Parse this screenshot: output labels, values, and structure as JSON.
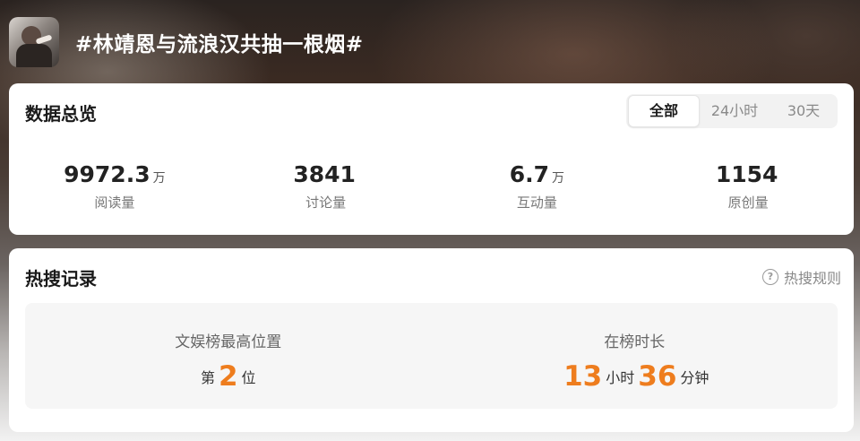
{
  "topic": {
    "title": "#林靖恩与流浪汉共抽一根烟#",
    "avatar_icon": "user-avatar"
  },
  "overview": {
    "title": "数据总览",
    "tabs": [
      {
        "label": "全部",
        "active": true
      },
      {
        "label": "24小时",
        "active": false
      },
      {
        "label": "30天",
        "active": false
      }
    ],
    "stats": [
      {
        "value": "9972.3",
        "unit": "万",
        "label": "阅读量"
      },
      {
        "value": "3841",
        "unit": "",
        "label": "讨论量"
      },
      {
        "value": "6.7",
        "unit": "万",
        "label": "互动量"
      },
      {
        "value": "1154",
        "unit": "",
        "label": "原创量"
      }
    ]
  },
  "hot_search": {
    "title": "热搜记录",
    "rules_link": "热搜规则",
    "rules_icon": "question-circle-icon",
    "best_position": {
      "label": "文娱榜最高位置",
      "prefix": "第",
      "rank": "2",
      "suffix": "位"
    },
    "duration": {
      "label": "在榜时长",
      "hours": "13",
      "hours_unit": "小时",
      "minutes": "36",
      "minutes_unit": "分钟"
    }
  },
  "colors": {
    "accent": "#ee7d1e",
    "card_bg": "#ffffff",
    "inner_bg": "#f6f6f6"
  }
}
